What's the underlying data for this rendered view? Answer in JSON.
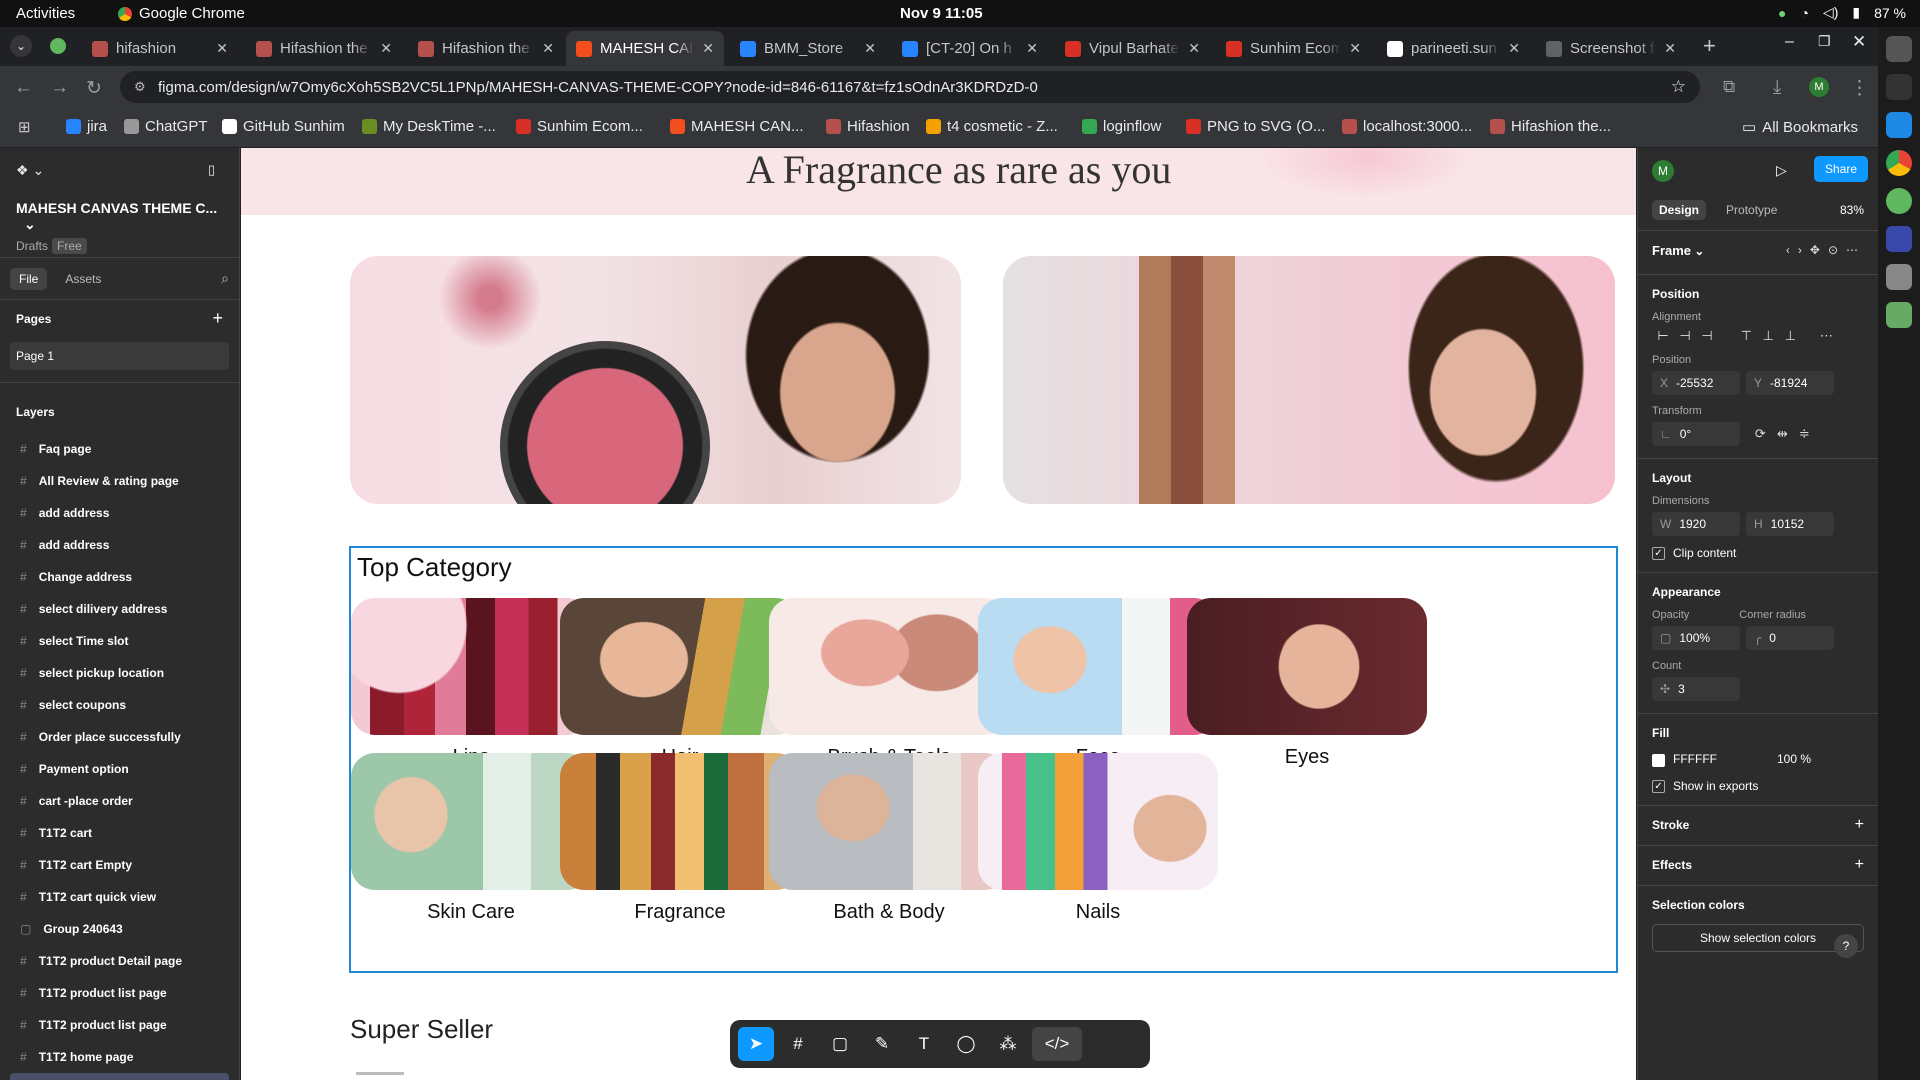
{
  "os": {
    "activities": "Activities",
    "app": "Google Chrome",
    "clock": "Nov 9  11:05",
    "battery": "87 %"
  },
  "tabs": [
    {
      "title": "hifashion",
      "color": "#b5504d"
    },
    {
      "title": "Hifashion the",
      "color": "#b5504d"
    },
    {
      "title": "Hifashion the",
      "color": "#b5504d"
    },
    {
      "title": "MAHESH CAI",
      "color": "#f24e1e"
    },
    {
      "title": "BMM_Store",
      "color": "#2684ff"
    },
    {
      "title": "[CT-20] On h",
      "color": "#2684ff"
    },
    {
      "title": "Vipul Barhate",
      "color": "#d93025"
    },
    {
      "title": "Sunhim Ecom",
      "color": "#d93025"
    },
    {
      "title": "parineeti.sun",
      "color": "#ffffff"
    },
    {
      "title": "Screenshot fr",
      "color": "#5f6368"
    }
  ],
  "url": "figma.com/design/w7Omy6cXoh5SB2VC5L1PNp/MAHESH-CANVAS-THEME-COPY?node-id=846-61167&t=fz1sOdnAr3KDRDzD-0",
  "bookmarks": [
    "jira",
    "ChatGPT",
    "GitHub Sunhim",
    "My DeskTime -...",
    "Sunhim Ecom...",
    "MAHESH CAN...",
    "Hifashion",
    "t4 cosmetic - Z...",
    "loginflow",
    "PNG to SVG (O...",
    "localhost:3000...",
    "Hifashion the..."
  ],
  "all_bookmarks": "All Bookmarks",
  "file": {
    "name": "MAHESH CANVAS THEME C...",
    "drafts": "Drafts",
    "plan": "Free",
    "tab_file": "File",
    "tab_assets": "Assets",
    "pages_title": "Pages",
    "page": "Page 1",
    "layers_title": "Layers"
  },
  "layers": [
    "Faq page",
    "All Review & rating page",
    "add address",
    "add address",
    "Change address",
    "select dilivery address",
    "select Time slot",
    "select pickup location",
    "select coupons",
    "Order place successfully",
    "Payment option",
    "cart -place order",
    "T1T2 cart",
    "T1T2 cart Empty",
    "T1T2 cart quick view",
    "Group 240643",
    "T1T2 product Detail page",
    "T1T2 product list page",
    "T1T2 product list page",
    "T1T2 home page",
    "T1T2 home page"
  ],
  "canvas": {
    "hero": "A Fragrance as rare as you",
    "top_category": "Top Category",
    "categories": [
      "Lips",
      "Hair",
      "Brush & Tools",
      "Face",
      "Eyes",
      "Skin Care",
      "Fragrance",
      "Bath & Body",
      "Nails"
    ],
    "super_seller": "Super Seller"
  },
  "design": {
    "avatar": "M",
    "share": "Share",
    "tab_design": "Design",
    "tab_prototype": "Prototype",
    "zoom": "83%",
    "frame": "Frame",
    "position": "Position",
    "alignment": "Alignment",
    "position_label": "Position",
    "x_label": "X",
    "x": "-25532",
    "y_label": "Y",
    "y": "-81924",
    "transform": "Transform",
    "rotation": "0°",
    "layout": "Layout",
    "dimensions": "Dimensions",
    "w_label": "W",
    "w": "1920",
    "h_label": "H",
    "h": "10152",
    "clip": "Clip content",
    "appearance": "Appearance",
    "opacity_label": "Opacity",
    "opacity": "100%",
    "radius_label": "Corner radius",
    "radius": "0",
    "count_label": "Count",
    "count": "3",
    "fill": "Fill",
    "fill_hex": "FFFFFF",
    "fill_opacity": "100",
    "fill_pct": "%",
    "show_exports": "Show in exports",
    "stroke": "Stroke",
    "effects": "Effects",
    "selection_colors": "Selection colors",
    "show_selection_colors": "Show selection colors",
    "help": "?"
  }
}
